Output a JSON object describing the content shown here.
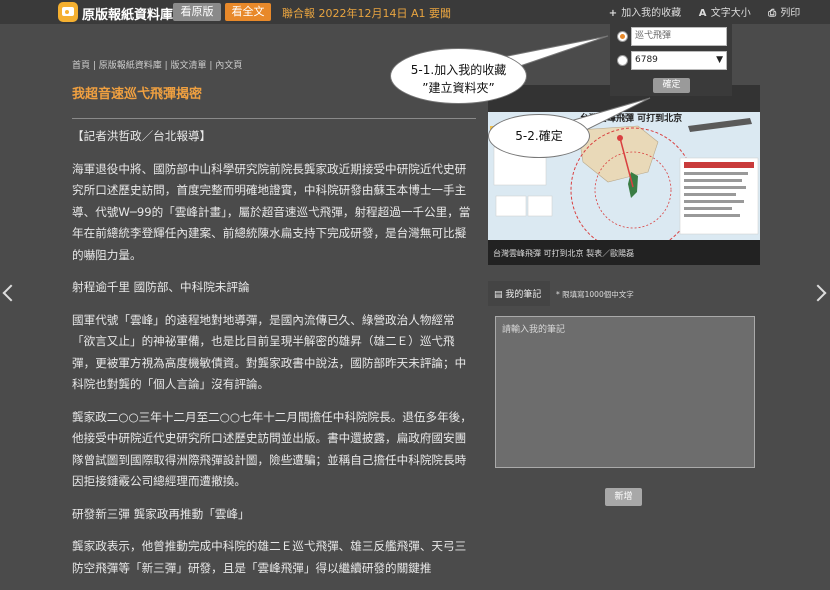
{
  "header": {
    "site_name": "原版報紙資料庫",
    "view_button": "看原版",
    "full_text_button": "看全文",
    "issue_info": "聯合報 2022年12月14日 A1 要聞",
    "add_favorite": "加入我的收藏",
    "font_size": "文字大小",
    "print": "列印"
  },
  "breadcrumb": "首頁 | 原版報紙資料庫 | 版文清單 | 內文頁",
  "article": {
    "title": "我超音速巡弋飛彈揭密",
    "paragraphs": [
      "【記者洪哲政／台北報導】",
      "海軍退役中將、國防部中山科學研究院前院長龔家政近期接受中研院近代史研究所口述歷史訪問，首度完整而明確地證實，中科院研發由蘇玉本博士一手主導、代號W─99的「雲峰計畫」，屬於超音速巡弋飛彈，射程超過一千公里，當年在前總統李登輝任內建案、前總統陳水扁支持下完成研發，是台灣無可比擬的嚇阻力量。",
      "射程逾千里 國防部、中科院未評論",
      "國軍代號「雲峰」的遠程地對地導彈，是國內流傳已久、綠營政治人物經常「欲言又止」的神祕軍備，也是比目前呈現半解密的雄昇（雄二Ｅ）巡弋飛彈，更被軍方視為高度機敏債資。對龔家政書中說法，國防部昨天未評論；中科院也對龔的「個人言論」沒有評論。",
      "龔家政二○○三年十二月至二○○七年十二月間擔任中科院院長。退伍多年後，他接受中研院近代史研究所口述歷史訪問並出版。書中還披露，扁政府國安團隊曾試圖到國際取得洲際飛彈設計圖，險些遭騙；並稱自己擔任中科院院長時因拒接鏈霰公司總經理而遭撤換。",
      "研發新三彈 龔家政再推動「雲峰」",
      "龔家政表示，他曾推動完成中科院的雄二Ｅ巡弋飛彈、雄三反艦飛彈、天弓三防空飛彈等「新三彈」研發，且是「雲峰飛彈」得以繼續研發的關鍵推"
    ]
  },
  "favorite_panel": {
    "new_folder_value": "巡弋飛彈",
    "folder_select_value": "6789",
    "confirm_button": "確定"
  },
  "image": {
    "map_title": "台灣雲峰飛彈 可打到北京",
    "caption": "台灣雲峰飛彈 可打到北京 製表／歐陽磊"
  },
  "notes": {
    "tab_label": "我的筆記",
    "hint": "* 限填寫1000個中文字",
    "placeholder": "請輸入我的筆記",
    "add_button": "新增"
  },
  "annotations": {
    "callout1_line1": "5-1.加入我的收藏",
    "callout1_line2": "”建立資料夾”",
    "callout2": "5-2.確定"
  },
  "colors": {
    "background": "#4b4b4b",
    "topbar": "#3a3a3a",
    "accent_orange": "#e8892a",
    "title_orange": "#f0a040"
  }
}
